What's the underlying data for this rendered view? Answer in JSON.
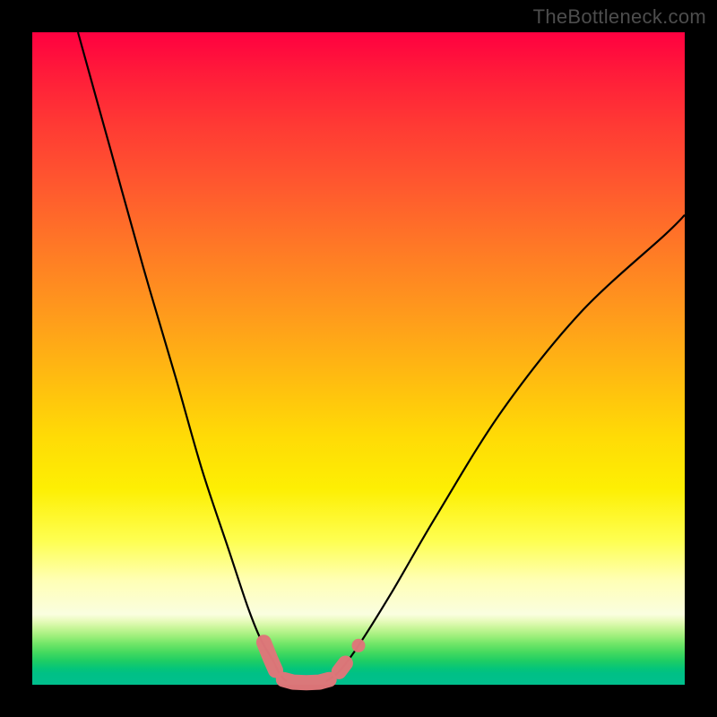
{
  "watermark": "TheBottleneck.com",
  "colors": {
    "frame": "#000000",
    "curve": "#000000",
    "marker": "#de7679",
    "gradient_stops": [
      {
        "pos": 0.0,
        "color": "#ff0040"
      },
      {
        "pos": 0.7,
        "color": "#fdef03"
      },
      {
        "pos": 0.89,
        "color": "#fafee0"
      },
      {
        "pos": 1.0,
        "color": "#00bf8d"
      }
    ]
  },
  "chart_data": {
    "type": "line",
    "title": "",
    "xlabel": "",
    "ylabel": "",
    "xlim": [
      0,
      100
    ],
    "ylim": [
      0,
      100
    ],
    "series": [
      {
        "name": "left-curve",
        "x": [
          7,
          12,
          17,
          22,
          26,
          30,
          33,
          35,
          37,
          38,
          39
        ],
        "y": [
          100,
          82,
          64,
          47,
          33,
          21,
          12,
          7,
          3.5,
          1.5,
          0.5
        ]
      },
      {
        "name": "right-curve",
        "x": [
          45,
          47,
          50,
          55,
          62,
          72,
          84,
          97,
          100
        ],
        "y": [
          0.5,
          2,
          6,
          14,
          26,
          42,
          57,
          69,
          72
        ]
      }
    ],
    "markers": [
      {
        "name": "left-cluster",
        "x": 35.5,
        "y": 6.5
      },
      {
        "name": "left-cluster",
        "x": 36.5,
        "y": 4.0
      },
      {
        "name": "left-cluster",
        "x": 37.3,
        "y": 2.2
      },
      {
        "name": "bottom-run",
        "x": 38.5,
        "y": 0.8
      },
      {
        "name": "bottom-run",
        "x": 40.0,
        "y": 0.4
      },
      {
        "name": "bottom-run",
        "x": 42.0,
        "y": 0.3
      },
      {
        "name": "bottom-run",
        "x": 44.0,
        "y": 0.4
      },
      {
        "name": "bottom-run",
        "x": 45.5,
        "y": 0.8
      },
      {
        "name": "right-tail",
        "x": 47.0,
        "y": 2.0
      },
      {
        "name": "right-tail",
        "x": 48.0,
        "y": 3.3
      },
      {
        "name": "right-lone-dot",
        "x": 50.0,
        "y": 6.0
      }
    ]
  }
}
